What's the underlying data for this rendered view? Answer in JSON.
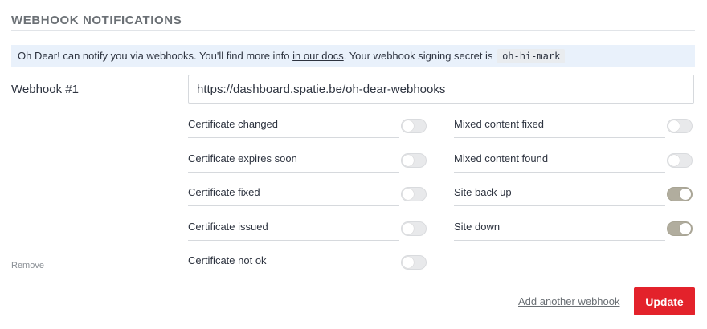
{
  "section": {
    "title": "WEBHOOK NOTIFICATIONS"
  },
  "info": {
    "text_before": "Oh Dear! can notify you via webhooks. You'll find more info ",
    "docs_link": "in our docs",
    "text_after": ". Your webhook signing secret is ",
    "secret": "oh-hi-mark"
  },
  "webhook": {
    "label": "Webhook #1",
    "url": "https://dashboard.spatie.be/oh-dear-webhooks"
  },
  "toggles_left": [
    {
      "label": "Certificate changed",
      "on": false
    },
    {
      "label": "Certificate expires soon",
      "on": false
    },
    {
      "label": "Certificate fixed",
      "on": false
    },
    {
      "label": "Certificate issued",
      "on": false
    },
    {
      "label": "Certificate not ok",
      "on": false
    }
  ],
  "toggles_right": [
    {
      "label": "Mixed content fixed",
      "on": false
    },
    {
      "label": "Mixed content found",
      "on": false
    },
    {
      "label": "Site back up",
      "on": true
    },
    {
      "label": "Site down",
      "on": true
    }
  ],
  "actions": {
    "remove_label": "Remove",
    "add_label": "Add another webhook",
    "update_label": "Update"
  },
  "colors": {
    "accent": "#e3222b",
    "toggle_on": "#b1ad9e",
    "banner_bg": "#e9f1fb"
  }
}
